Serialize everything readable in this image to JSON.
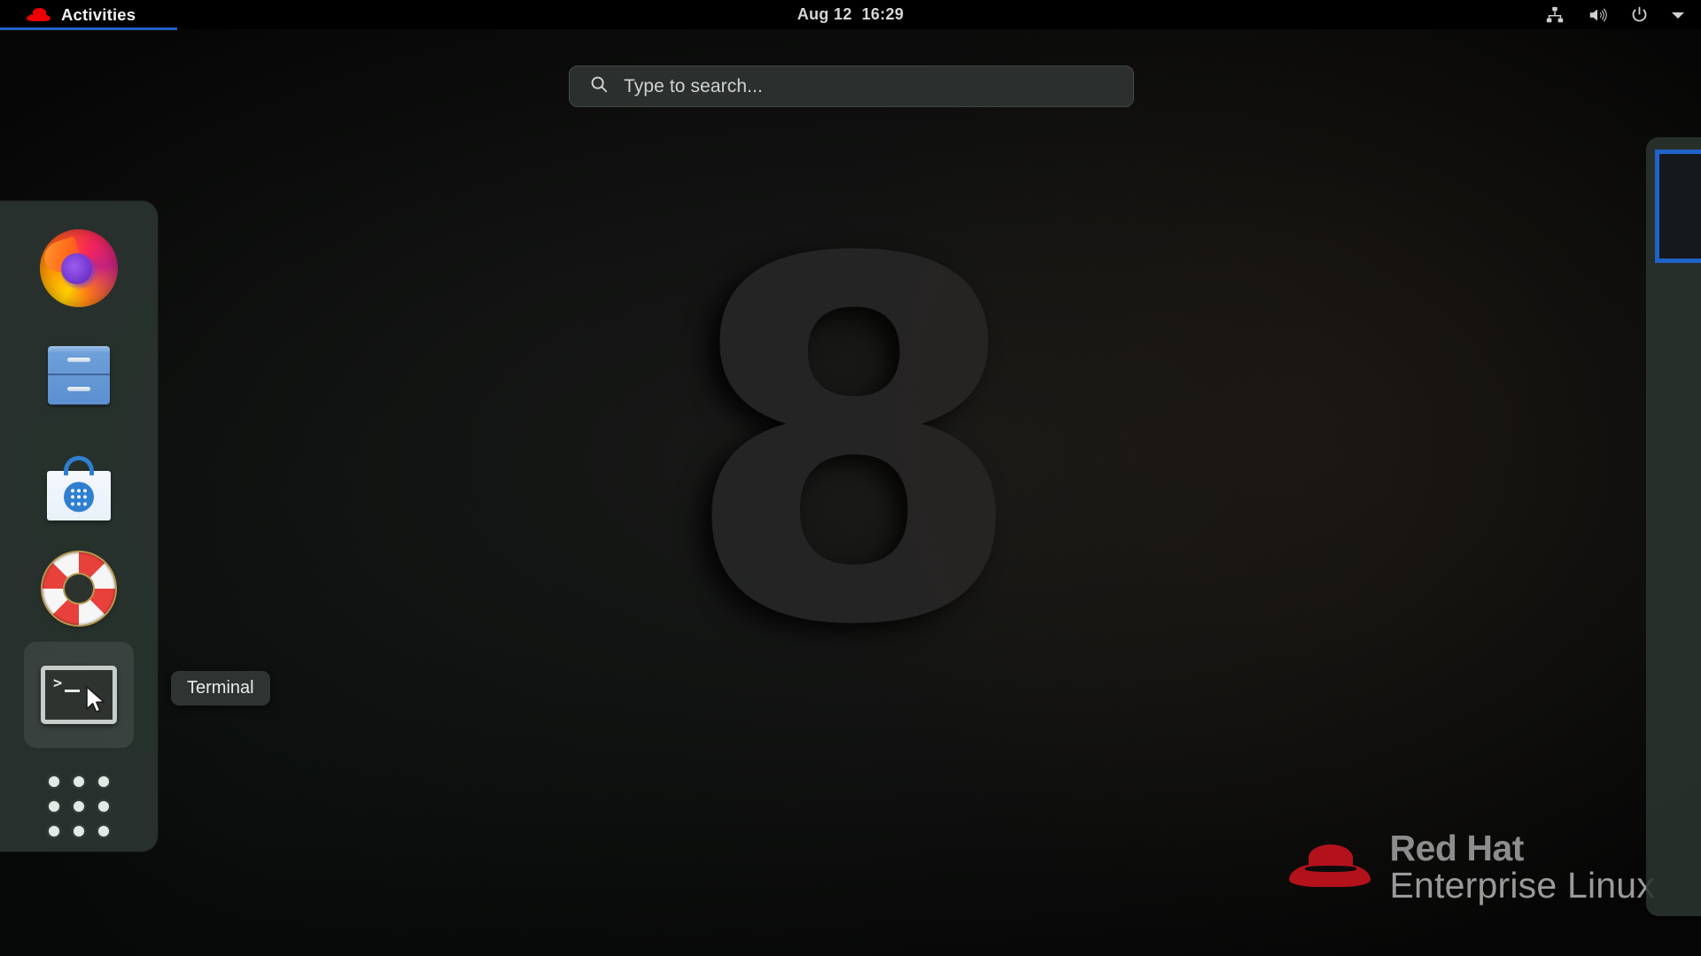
{
  "topbar": {
    "activities_label": "Activities",
    "activities_icon": "redhat-logo-icon",
    "clock_date": "Aug 12",
    "clock_time": "16:29",
    "status_icons": [
      {
        "name": "network-wired-icon"
      },
      {
        "name": "volume-speaker-icon"
      },
      {
        "name": "power-icon"
      },
      {
        "name": "chevron-down-icon"
      }
    ]
  },
  "search": {
    "placeholder": "Type to search...",
    "value": "",
    "icon": "search-icon"
  },
  "dock": {
    "items": [
      {
        "id": "firefox",
        "label": "Firefox",
        "icon": "firefox-icon"
      },
      {
        "id": "files",
        "label": "Files",
        "icon": "files-cabinet-icon"
      },
      {
        "id": "software",
        "label": "Software",
        "icon": "software-bag-icon"
      },
      {
        "id": "help",
        "label": "Help",
        "icon": "lifebuoy-help-icon"
      },
      {
        "id": "terminal",
        "label": "Terminal",
        "icon": "terminal-icon"
      }
    ],
    "show_apps_label": "Show Applications",
    "show_apps_icon": "app-grid-icon",
    "tooltip": "Terminal"
  },
  "wallpaper": {
    "numeral": "8",
    "brand_line1": "Red Hat",
    "brand_line2": "Enterprise Linux",
    "brand_logo_icon": "redhat-fedora-icon"
  },
  "workspaces": {
    "active_index": 0,
    "thumbnails": [
      {
        "name": "workspace-1"
      }
    ]
  },
  "colors": {
    "accent_blue": "#1f63c8",
    "redhat_red": "#b3121b",
    "dock_bg": "#2a342f",
    "desktop_bg": "#0a0b0a"
  }
}
